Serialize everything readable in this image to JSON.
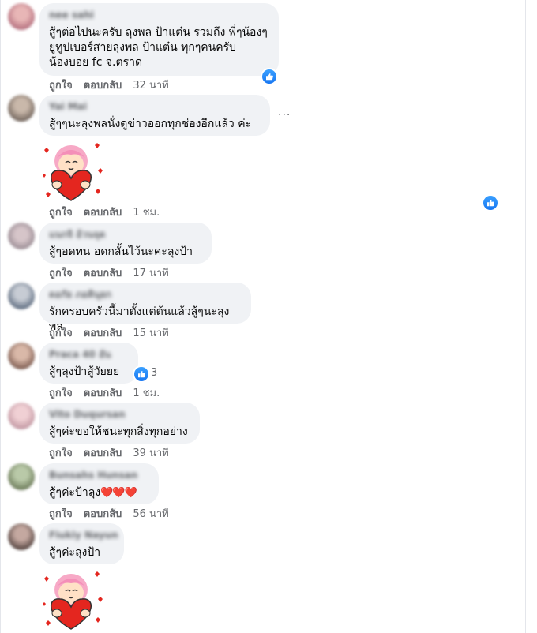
{
  "actions": {
    "like": "ถูกใจ",
    "reply": "ตอบกลับ"
  },
  "comments": [
    {
      "name": "nee sahi",
      "text": "สู้ๆต่อไปนะครับ ลุงพล ป้าแต๋น รวมถึง พี่ๆน้องๆ\nยูทูปเบอร์สายลุงพล ป้าแต๋น ทุกๆคนครับ\nน้องบอย fc จ.ตราด",
      "time": "32 นาที"
    },
    {
      "name": "Yai Mai",
      "text": "สู้ๆๆนะลุงพลนั่งดูข่าวออกทุกช่องอีกแล้ว ค่ะ",
      "time": "1 ชม.",
      "sticker": "bear-heart-sticker"
    },
    {
      "name": "แนกจิ อ้วนจุด",
      "text": "สู้ๆอดทน อดกลั้นไว้นะคะลุงป้า",
      "time": "17 นาที"
    },
    {
      "name": "ดอกัย ภอคินุยก",
      "text": "รักครอบครัวนี้มาตั้งแต่ต้นแล้วสู้ๆนะลุงพล",
      "time": "15 นาที"
    },
    {
      "name": "Praca 40 อัน",
      "text": "สู้ๆลุงป้าสู้วัยยย",
      "time": "1 ชม.",
      "reactions": "3"
    },
    {
      "name": "Vito Duqursan",
      "text": "สู้ๆค่ะขอให้ชนะทุกสิ่งทุกอย่าง",
      "time": "39 นาที"
    },
    {
      "name": "Bunsahs Hunsan",
      "text": "สู้ๆค่ะป้าลุง",
      "hearts": "❤️❤️❤️",
      "time": "56 นาที"
    },
    {
      "name": "Fiukiy Nayun",
      "text": "สู้ๆค่ะลุงป้า",
      "sticker": "bear-heart-sticker"
    }
  ],
  "more_label": "···",
  "colors": {
    "bubble": "#f0f2f5",
    "meta": "#65676b",
    "like_blue": "#1877f2",
    "heart_red": "#e4261f"
  }
}
